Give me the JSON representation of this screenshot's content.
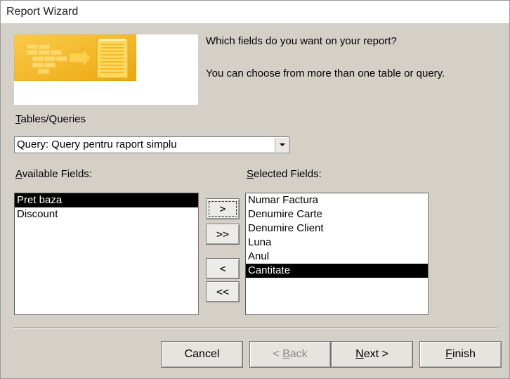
{
  "window": {
    "title": "Report Wizard"
  },
  "intro": {
    "question": "Which fields do you want on your report?",
    "hint": "You can choose from more than one table or query."
  },
  "tables_queries": {
    "label_accel": "T",
    "label_rest": "ables/Queries",
    "selected": "Query: Query pentru raport simplu"
  },
  "available": {
    "label_accel": "A",
    "label_rest": "vailable Fields:",
    "items": [
      {
        "label": "Pret baza",
        "selected": true
      },
      {
        "label": "Discount",
        "selected": false
      }
    ]
  },
  "selected_fields": {
    "label_accel": "S",
    "label_rest": "elected Fields:",
    "items": [
      {
        "label": "Numar Factura",
        "selected": false
      },
      {
        "label": "Denumire Carte",
        "selected": false
      },
      {
        "label": "Denumire Client",
        "selected": false
      },
      {
        "label": "Luna",
        "selected": false
      },
      {
        "label": "Anul",
        "selected": false
      },
      {
        "label": "Cantitate",
        "selected": true
      }
    ]
  },
  "move_buttons": {
    "add_one": ">",
    "add_all": ">>",
    "remove_one": "<",
    "remove_all": "<<"
  },
  "footer": {
    "cancel": "Cancel",
    "back_prefix": "< ",
    "back_accel": "B",
    "back_rest": "ack",
    "next_accel": "N",
    "next_rest": "ext >",
    "finish_accel": "F",
    "finish_rest": "inish"
  },
  "colors": {
    "dialog_bg": "#d4d0c8",
    "selection_bg": "#000000",
    "banner_gold": "#f2b21d"
  }
}
